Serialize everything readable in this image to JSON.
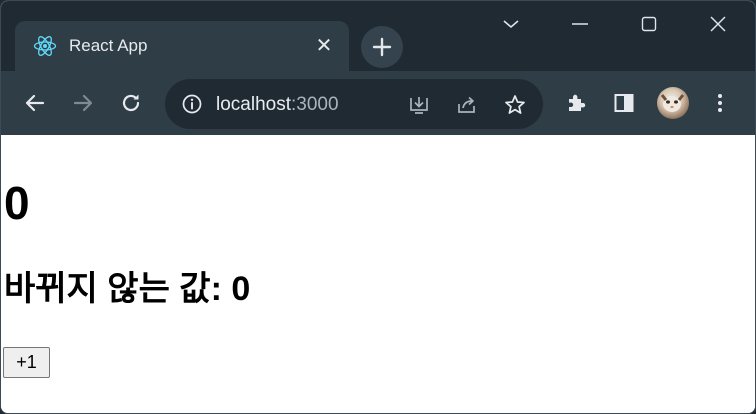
{
  "browser": {
    "tab": {
      "title": "React App",
      "icon": "react-logo-icon",
      "close_glyph": "✕"
    },
    "new_tab_icon": "plus-icon",
    "window_controls": [
      "chevron-down-icon",
      "minimize-icon",
      "maximize-icon",
      "close-icon"
    ],
    "omnibox": {
      "host": "localhost",
      "port": ":3000"
    },
    "colors": {
      "frame": "#1f2a33",
      "toolbar": "#2f3d47",
      "react_accent": "#61dafb"
    }
  },
  "page": {
    "count_value": "0",
    "stable_label": "바뀌지 않는 값: 0",
    "increment_button_label": "+1"
  }
}
